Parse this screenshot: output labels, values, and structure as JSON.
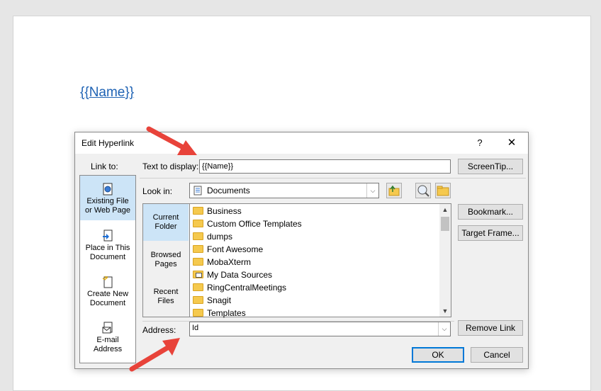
{
  "document": {
    "field_text": "{{Name}}"
  },
  "dialog": {
    "title": "Edit Hyperlink",
    "help": "?",
    "close": "✕",
    "link_to_label": "Link to:",
    "link_to_items": [
      {
        "line1": "Existing File",
        "line2": "or Web Page",
        "icon": "globe-file-icon"
      },
      {
        "line1": "Place in This",
        "line2": "Document",
        "icon": "document-place-icon"
      },
      {
        "line1": "Create New",
        "line2": "Document",
        "icon": "new-document-icon"
      },
      {
        "line1": "E-mail",
        "line2": "Address",
        "icon": "email-icon"
      }
    ],
    "text_to_display_label": "Text to display:",
    "text_to_display_value": "{{Name}}",
    "screentip": "ScreenTip...",
    "look_in_label": "Look in:",
    "look_in_value": "Documents",
    "nav_items": [
      {
        "line1": "Current",
        "line2": "Folder"
      },
      {
        "line1": "Browsed",
        "line2": "Pages"
      },
      {
        "line1": "Recent",
        "line2": "Files"
      }
    ],
    "files": [
      "Business",
      "Custom Office Templates",
      "dumps",
      "Font Awesome",
      "MobaXterm",
      "My Data Sources",
      "RingCentralMeetings",
      "Snagit",
      "Templates"
    ],
    "bookmark": "Bookmark...",
    "target_frame": "Target Frame...",
    "address_label": "Address:",
    "address_value": "Id",
    "remove_link": "Remove Link",
    "ok": "OK",
    "cancel": "Cancel"
  },
  "colors": {
    "accent": "#0078d7",
    "selection": "#cce4f7",
    "annotation_arrow": "#e8433a",
    "link": "#1f63b4"
  }
}
